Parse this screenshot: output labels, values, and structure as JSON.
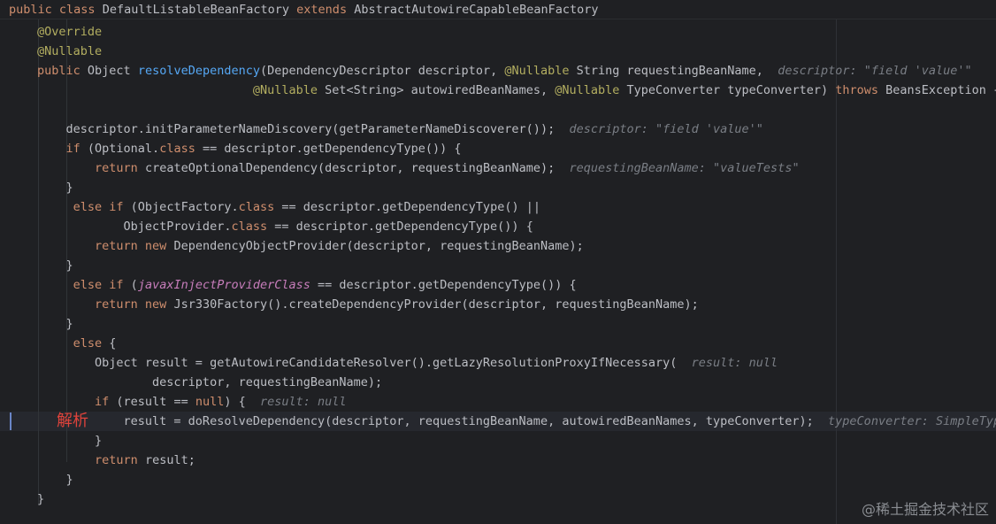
{
  "header": {
    "kw_public": "public",
    "kw_class": "class",
    "class_name": "DefaultListableBeanFactory",
    "kw_extends": "extends",
    "super_name": "AbstractAutowireCapableBeanFactory"
  },
  "annotation_label": "解析",
  "watermark": "@稀土掘金技术社区",
  "colors": {
    "background": "#1f2023",
    "keyword": "#cf8e6d",
    "function": "#56a8f5",
    "annotation": "#b3ae60",
    "field": "#c77dbb",
    "hint": "#7a7e85",
    "text": "#bcbec4",
    "label": "#e0433b"
  },
  "lines": [
    [
      {
        "t": "@Override",
        "c": "anno"
      }
    ],
    [
      {
        "t": "@Nullable",
        "c": "anno"
      }
    ],
    [
      {
        "t": "public",
        "c": "kw"
      },
      {
        "t": " Object "
      },
      {
        "t": "resolveDependency",
        "c": "fn"
      },
      {
        "t": "(DependencyDescriptor descriptor, "
      },
      {
        "t": "@Nullable",
        "c": "anno"
      },
      {
        "t": " String requestingBeanName,  "
      },
      {
        "t": "descriptor: \"field 'value'\"    reque",
        "c": "hint"
      }
    ],
    [
      {
        "t": "                              "
      },
      {
        "t": "@Nullable",
        "c": "anno"
      },
      {
        "t": " Set<String> autowiredBeanNames, "
      },
      {
        "t": "@Nullable",
        "c": "anno"
      },
      {
        "t": " TypeConverter typeConverter) "
      },
      {
        "t": "throws",
        "c": "kw"
      },
      {
        "t": " BeansException {   t"
      }
    ],
    [],
    [
      {
        "t": "    descriptor.initParameterNameDiscovery(getParameterNameDiscoverer());  "
      },
      {
        "t": "descriptor: \"field 'value'\"",
        "c": "hint"
      }
    ],
    [
      {
        "t": "    "
      },
      {
        "t": "if",
        "c": "kw"
      },
      {
        "t": " (Optional."
      },
      {
        "t": "class",
        "c": "kw"
      },
      {
        "t": " == descriptor.getDependencyType()) {"
      }
    ],
    [
      {
        "t": "        "
      },
      {
        "t": "return",
        "c": "kw"
      },
      {
        "t": " createOptionalDependency(descriptor, requestingBeanName);  "
      },
      {
        "t": "requestingBeanName: \"valueTests\"",
        "c": "hint"
      }
    ],
    [
      {
        "t": "    }"
      }
    ],
    [
      {
        "t": "     "
      },
      {
        "t": "else if",
        "c": "kw"
      },
      {
        "t": " (ObjectFactory."
      },
      {
        "t": "class",
        "c": "kw"
      },
      {
        "t": " == descriptor.getDependencyType() ||"
      }
    ],
    [
      {
        "t": "            ObjectProvider."
      },
      {
        "t": "class",
        "c": "kw"
      },
      {
        "t": " == descriptor.getDependencyType()) {"
      }
    ],
    [
      {
        "t": "        "
      },
      {
        "t": "return new",
        "c": "kw"
      },
      {
        "t": " DependencyObjectProvider(descriptor, requestingBeanName);"
      }
    ],
    [
      {
        "t": "    }"
      }
    ],
    [
      {
        "t": "     "
      },
      {
        "t": "else if",
        "c": "kw"
      },
      {
        "t": " ("
      },
      {
        "t": "javaxInjectProviderClass",
        "c": "field"
      },
      {
        "t": " == descriptor.getDependencyType()) {"
      }
    ],
    [
      {
        "t": "        "
      },
      {
        "t": "return new",
        "c": "kw"
      },
      {
        "t": " Jsr330Factory().createDependencyProvider(descriptor, requestingBeanName);"
      }
    ],
    [
      {
        "t": "    }"
      }
    ],
    [
      {
        "t": "     "
      },
      {
        "t": "else",
        "c": "kw"
      },
      {
        "t": " {"
      }
    ],
    [
      {
        "t": "        Object result = getAutowireCandidateResolver().getLazyResolutionProxyIfNecessary(  "
      },
      {
        "t": "result: null",
        "c": "hint"
      }
    ],
    [
      {
        "t": "                descriptor, requestingBeanName);"
      }
    ],
    [
      {
        "t": "        "
      },
      {
        "t": "if",
        "c": "kw"
      },
      {
        "t": " (result == "
      },
      {
        "t": "null",
        "c": "kw"
      },
      {
        "t": ") {  "
      },
      {
        "t": "result: null",
        "c": "hint"
      }
    ],
    [
      {
        "t": "            result = doResolveDependency(descriptor, requestingBeanName, autowiredBeanNames, typeConverter);  "
      },
      {
        "t": "typeConverter: SimpleTypeConv",
        "c": "hint"
      }
    ],
    [
      {
        "t": "        }"
      }
    ],
    [
      {
        "t": "        "
      },
      {
        "t": "return",
        "c": "kw"
      },
      {
        "t": " result;"
      }
    ],
    [
      {
        "t": "    }"
      }
    ],
    [
      {
        "t": "}"
      }
    ]
  ]
}
